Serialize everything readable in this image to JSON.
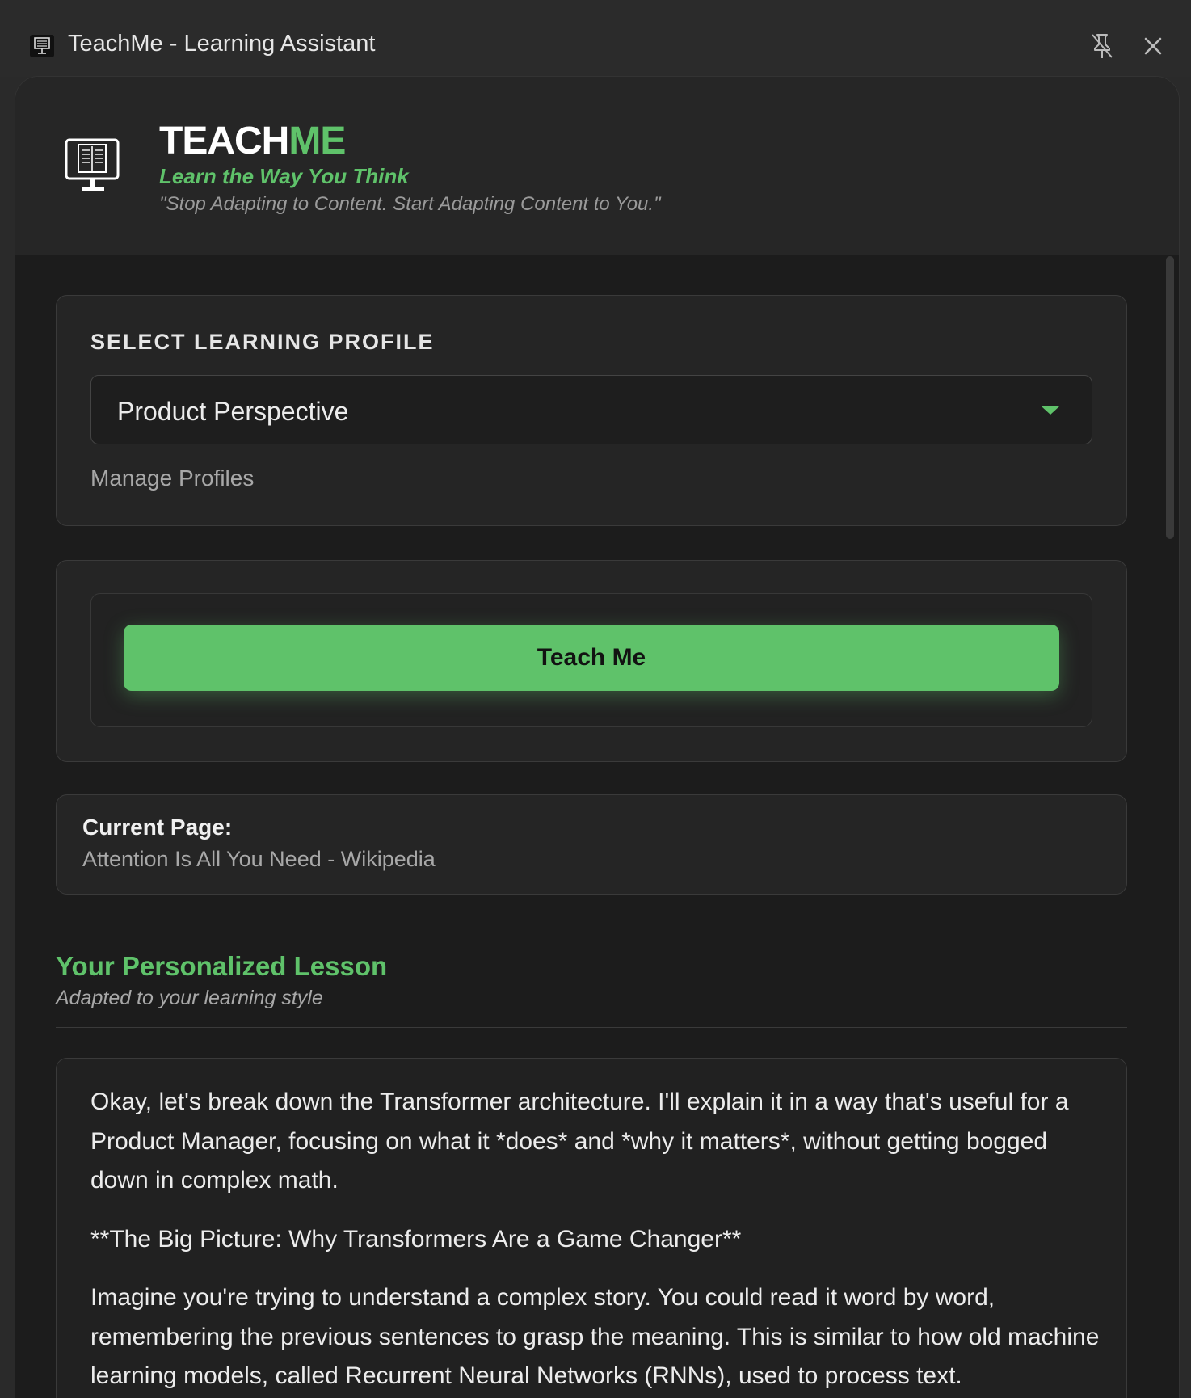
{
  "window": {
    "title": "TeachMe - Learning Assistant"
  },
  "header": {
    "brand_primary": "TEACH",
    "brand_accent": "ME",
    "tagline": "Learn the Way You Think",
    "quote": "\"Stop Adapting to Content. Start Adapting Content to You.\""
  },
  "profile": {
    "section_label": "SELECT LEARNING PROFILE",
    "selected": "Product Perspective",
    "manage_link": "Manage Profiles"
  },
  "actions": {
    "teach_label": "Teach Me"
  },
  "current_page": {
    "label": "Current Page:",
    "value": "Attention Is All You Need - Wikipedia"
  },
  "lesson": {
    "title": "Your Personalized Lesson",
    "subtitle": "Adapted to your learning style",
    "paragraphs": [
      "Okay, let's break down the Transformer architecture. I'll explain it in a way that's useful for a Product Manager, focusing on what it *does* and *why it matters*, without getting bogged down in complex math.",
      "**The Big Picture: Why Transformers Are a Game Changer**",
      "Imagine you're trying to understand a complex story. You could read it word by word, remembering the previous sentences to grasp the meaning. This is similar to how old machine learning models, called Recurrent Neural Networks (RNNs), used to process text."
    ]
  },
  "colors": {
    "accent": "#5fc26a",
    "background": "#1c1c1c",
    "card": "#252525"
  }
}
